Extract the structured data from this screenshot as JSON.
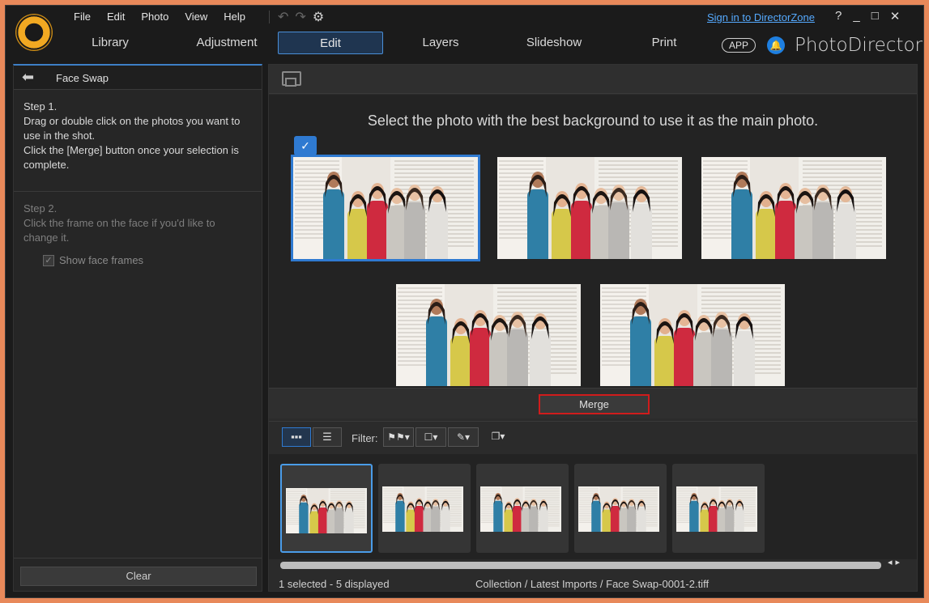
{
  "app": {
    "brand": "PhotoDirector",
    "signin": "Sign in to DirectorZone",
    "app_badge": "APP"
  },
  "menu": [
    "File",
    "Edit",
    "Photo",
    "View",
    "Help"
  ],
  "window_controls": [
    "?",
    "_",
    "□",
    "✕"
  ],
  "tabs": [
    {
      "label": "Library",
      "active": false
    },
    {
      "label": "Adjustment",
      "active": false
    },
    {
      "label": "Edit",
      "active": true
    },
    {
      "label": "Layers",
      "active": false
    },
    {
      "label": "Slideshow",
      "active": false
    },
    {
      "label": "Print",
      "active": false
    }
  ],
  "panel": {
    "title": "Face Swap",
    "step1": {
      "heading": "Step 1.",
      "line1": "Drag or double click on the photos you want to use in the shot.",
      "line2": "Click the [Merge] button once your selection is complete."
    },
    "step2": {
      "heading": "Step 2.",
      "line1": "Click the frame on the face if you'd like to change it.",
      "checkbox_label": "Show face frames",
      "checked": true
    },
    "clear_label": "Clear"
  },
  "stage": {
    "instruction": "Select the photo with the best background to use it as the main photo.",
    "merge_label": "Merge"
  },
  "filmstrip": {
    "filter_label": "Filter:",
    "thumb_count": 5,
    "selected_index": 0
  },
  "status": {
    "selection": "1 selected - 5 displayed",
    "path": "Collection / Latest Imports / Face Swap-0001-2.tiff"
  },
  "colors": {
    "accent": "#2f7ad1",
    "merge_highlight": "#d01c1c",
    "frame": "#e8895a"
  }
}
